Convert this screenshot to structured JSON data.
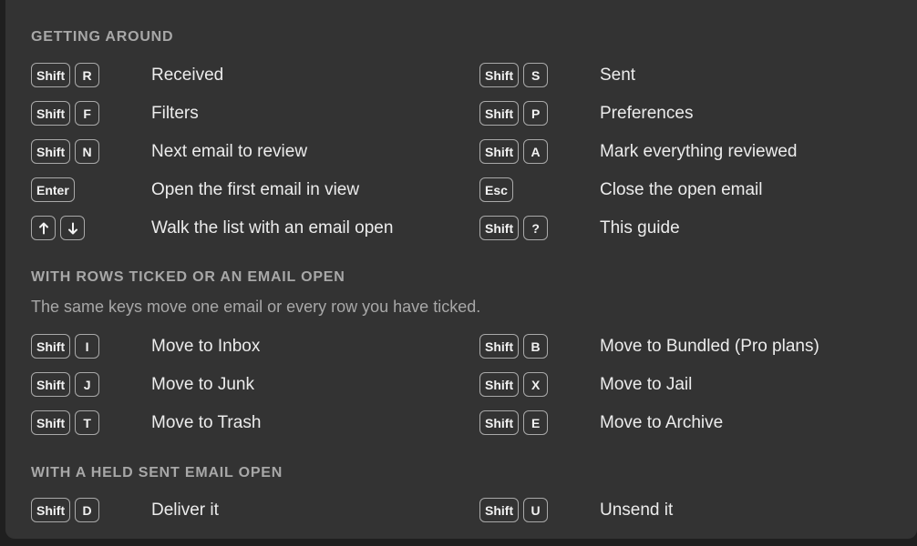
{
  "sections": [
    {
      "title": "GETTING AROUND",
      "rows": [
        [
          {
            "keys": [
              "Shift",
              "R"
            ],
            "label": "Received"
          },
          {
            "keys": [
              "Shift",
              "S"
            ],
            "label": "Sent"
          }
        ],
        [
          {
            "keys": [
              "Shift",
              "F"
            ],
            "label": "Filters"
          },
          {
            "keys": [
              "Shift",
              "P"
            ],
            "label": "Preferences"
          }
        ],
        [
          {
            "keys": [
              "Shift",
              "N"
            ],
            "label": "Next email to review"
          },
          {
            "keys": [
              "Shift",
              "A"
            ],
            "label": "Mark everything reviewed"
          }
        ],
        [
          {
            "keys": [
              "Enter"
            ],
            "label": "Open the first email in view"
          },
          {
            "keys": [
              "Esc"
            ],
            "label": "Close the open email"
          }
        ],
        [
          {
            "keys": [
              "arrow-up-icon",
              "arrow-down-icon"
            ],
            "label": "Walk the list with an email open"
          },
          {
            "keys": [
              "Shift",
              "?"
            ],
            "label": "This guide"
          }
        ]
      ]
    },
    {
      "title": "WITH ROWS TICKED OR AN EMAIL OPEN",
      "note": "The same keys move one email or every row you have ticked.",
      "rows": [
        [
          {
            "keys": [
              "Shift",
              "I"
            ],
            "label": "Move to Inbox"
          },
          {
            "keys": [
              "Shift",
              "B"
            ],
            "label": "Move to Bundled (Pro plans)"
          }
        ],
        [
          {
            "keys": [
              "Shift",
              "J"
            ],
            "label": "Move to Junk"
          },
          {
            "keys": [
              "Shift",
              "X"
            ],
            "label": "Move to Jail"
          }
        ],
        [
          {
            "keys": [
              "Shift",
              "T"
            ],
            "label": "Move to Trash"
          },
          {
            "keys": [
              "Shift",
              "E"
            ],
            "label": "Move to Archive"
          }
        ]
      ]
    },
    {
      "title": "WITH A HELD SENT EMAIL OPEN",
      "rows": [
        [
          {
            "keys": [
              "Shift",
              "D"
            ],
            "label": "Deliver it"
          },
          {
            "keys": [
              "Shift",
              "U"
            ],
            "label": "Unsend it"
          }
        ]
      ]
    }
  ]
}
